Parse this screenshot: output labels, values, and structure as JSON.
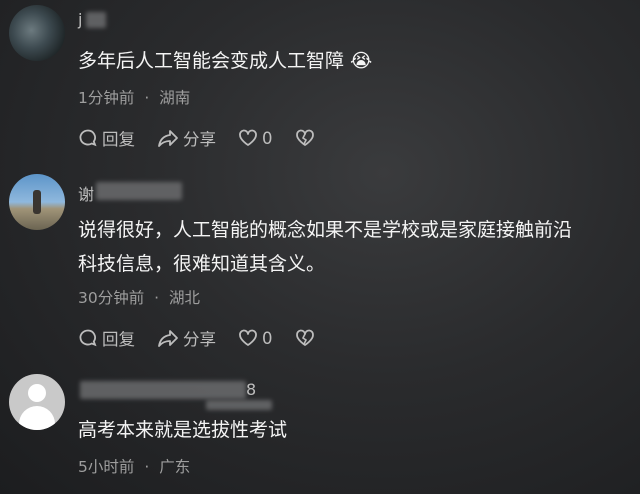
{
  "comments": [
    {
      "username": "j",
      "text": "多年后人工智能会变成人工智障 😭",
      "time": "1分钟前",
      "location": "湖南",
      "reply_label": "回复",
      "share_label": "分享",
      "likes": "0"
    },
    {
      "username": "谢",
      "text_line1": "说得很好，人工智能的概念如果不是学校或是家庭接触前沿",
      "text_line2": "科技信息，很难知道其含义。",
      "time": "30分钟前",
      "location": "湖北",
      "reply_label": "回复",
      "share_label": "分享",
      "likes": "0"
    },
    {
      "username": "8",
      "text": "高考本来就是选拔性考试",
      "time": "5小时前",
      "location": "广东"
    }
  ],
  "meta_separator": "·",
  "icons": [
    "comment-icon",
    "share-icon",
    "heart-icon",
    "broken-heart-icon"
  ]
}
